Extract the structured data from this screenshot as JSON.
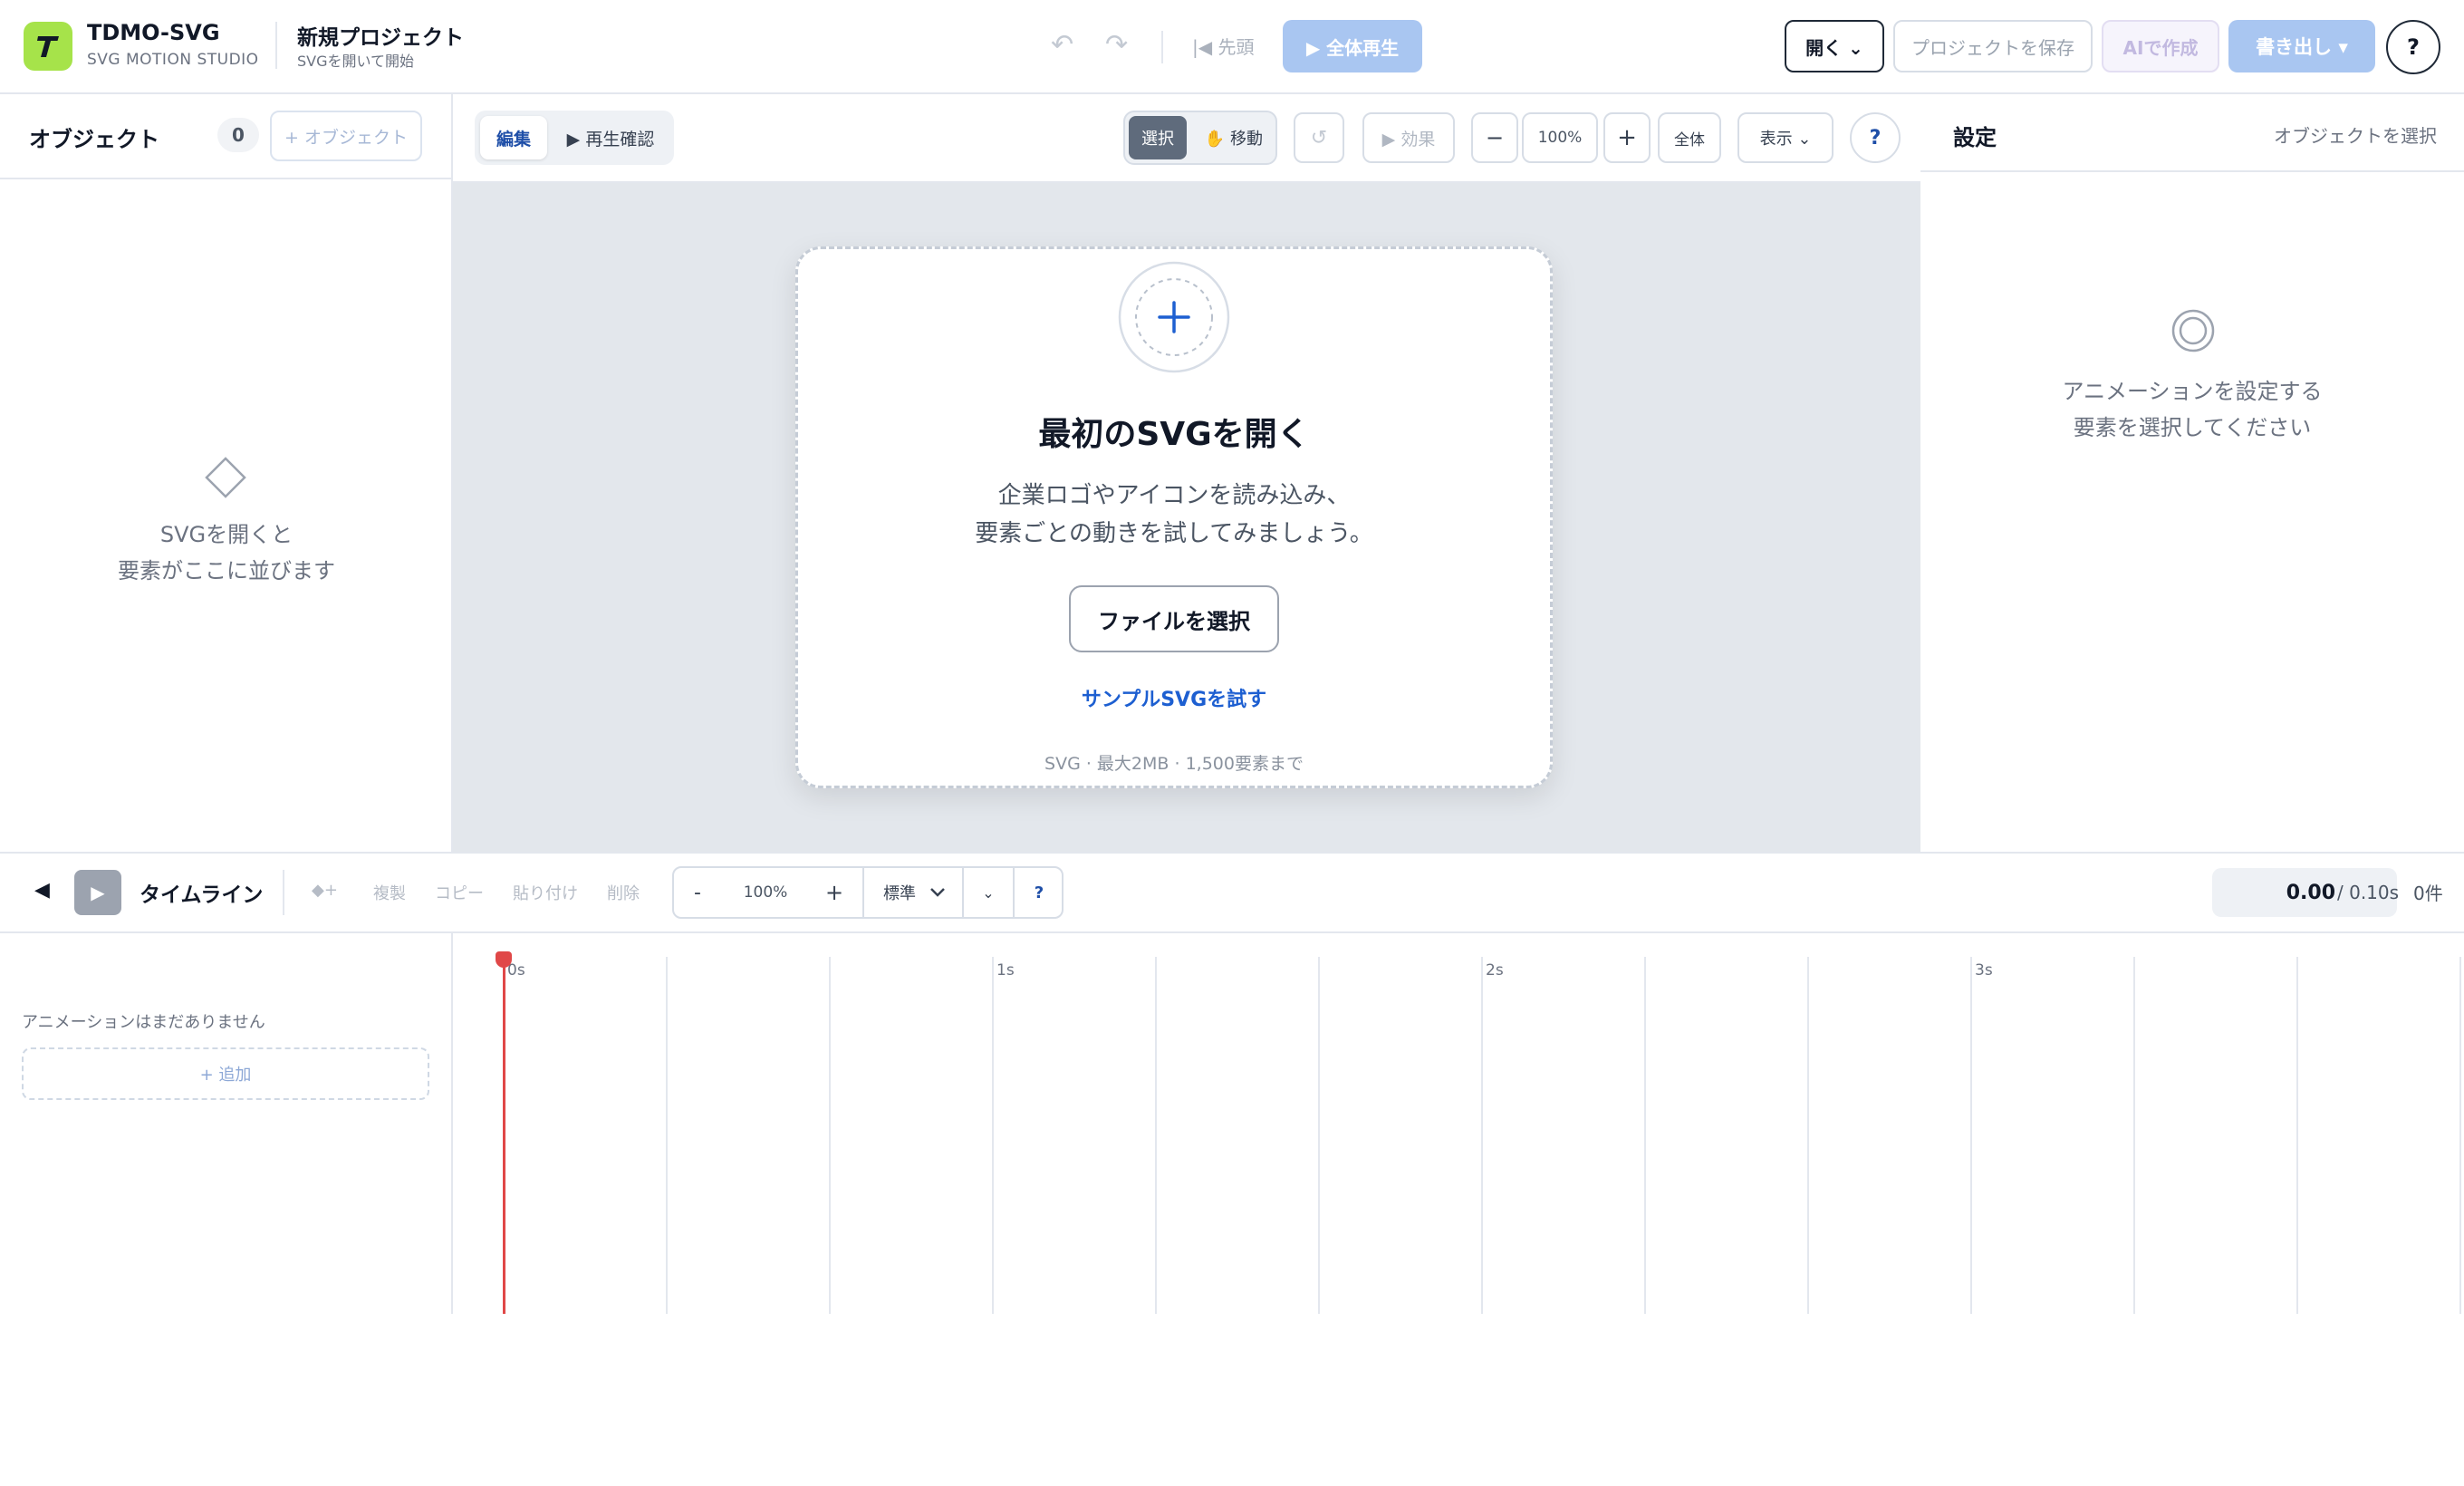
{
  "header": {
    "app_name": "TDMO-SVG",
    "app_sub": "SVG MOTION STUDIO",
    "project_name": "新規プロジェクト",
    "project_sub": "SVGを開いて開始",
    "undo_icon": "↶",
    "redo_icon": "↷",
    "to_start": "|◀ 先頭",
    "play_all": "▶ 全体再生",
    "open": "開く ⌄",
    "save_project": "プロジェクトを保存",
    "ai_create": "AIで作成",
    "export": "書き出し ▾",
    "help": "?",
    "accent_color": "#a6e34a"
  },
  "objects_panel": {
    "title": "オブジェクト",
    "count": "0",
    "add_button": "+ オブジェクト",
    "empty_line1": "SVGを開くと",
    "empty_line2": "要素がここに並びます"
  },
  "canvas_toolbar": {
    "tab_edit": "編集",
    "tab_preview": "▶ 再生確認",
    "tool_select": "選択",
    "tool_move": "✋ 移動",
    "reset_icon": "↺",
    "effect": "▶ 効果",
    "zoom_minus": "−",
    "zoom_value": "100%",
    "zoom_plus": "+",
    "zoom_fit": "全体",
    "view": "表示 ⌄",
    "help": "?"
  },
  "drop_card": {
    "title": "最初のSVGを開く",
    "desc_line1": "企業ロゴやアイコンを読み込み、",
    "desc_line2": "要素ごとの動きを試してみましょう。",
    "choose_file": "ファイルを選択",
    "sample_link": "サンプルSVGを試す",
    "limits": "SVG · 最大2MB · 1,500要素まで"
  },
  "settings_panel": {
    "title": "設定",
    "select_hint": "オブジェクトを選択",
    "empty_line1": "アニメーションを設定する",
    "empty_line2": "要素を選択してください"
  },
  "timeline": {
    "collapse_icon": "◀",
    "play_icon": "▶",
    "title": "タイムライン",
    "keyframe": "◆+",
    "duplicate": "複製",
    "copy": "コピー",
    "paste": "貼り付け",
    "delete": "削除",
    "zoom_minus": "-",
    "zoom_value": "100%",
    "zoom_plus": "+",
    "speed": "標準",
    "speed_chevron": "⌄",
    "more": "⌄",
    "help": "?",
    "current_time": "0.00",
    "total_time": "/ 0.10s",
    "count": "0件",
    "empty": "アニメーションはまだありません",
    "add": "+ 追加",
    "ruler_labels": [
      "0s",
      "1s",
      "2s",
      "3s"
    ],
    "playhead_color": "#e04848"
  }
}
